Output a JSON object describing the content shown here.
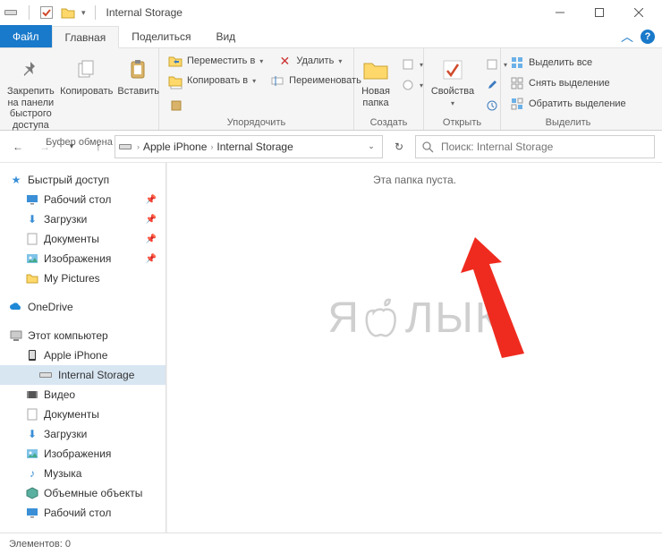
{
  "window": {
    "title": "Internal Storage"
  },
  "tabs": {
    "file": "Файл",
    "home": "Главная",
    "share": "Поделиться",
    "view": "Вид"
  },
  "ribbon": {
    "clipboard": {
      "label": "Буфер обмена",
      "pin": "Закрепить на панели быстрого доступа",
      "copy": "Копировать",
      "paste": "Вставить"
    },
    "organize": {
      "label": "Упорядочить",
      "move": "Переместить в",
      "copyto": "Копировать в",
      "delete": "Удалить",
      "rename": "Переименовать"
    },
    "new": {
      "label": "Создать",
      "newfolder": "Новая папка"
    },
    "open": {
      "label": "Открыть",
      "properties": "Свойства"
    },
    "select": {
      "label": "Выделить",
      "all": "Выделить все",
      "none": "Снять выделение",
      "invert": "Обратить выделение"
    }
  },
  "breadcrumb": {
    "seg1": "Apple iPhone",
    "seg2": "Internal Storage"
  },
  "search": {
    "placeholder": "Поиск: Internal Storage"
  },
  "tree": {
    "quick": "Быстрый доступ",
    "desktop": "Рабочий стол",
    "downloads": "Загрузки",
    "documents": "Документы",
    "pictures": "Изображения",
    "mypictures": "My Pictures",
    "onedrive": "OneDrive",
    "thispc": "Этот компьютер",
    "iphone": "Apple iPhone",
    "internal": "Internal Storage",
    "video": "Видео",
    "docs2": "Документы",
    "downloads2": "Загрузки",
    "pictures2": "Изображения",
    "music": "Музыка",
    "volumes": "Объемные объекты",
    "desktop2": "Рабочий стол"
  },
  "content": {
    "empty": "Эта папка пуста.",
    "watermark_left": "Я",
    "watermark_right": "ЛЫК"
  },
  "status": {
    "items": "Элементов: 0"
  }
}
